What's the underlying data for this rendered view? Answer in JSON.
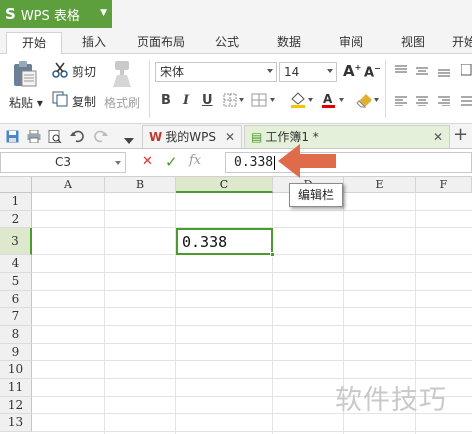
{
  "app": {
    "logo": "S",
    "name": "WPS 表格"
  },
  "ribbon": {
    "active_tab": "开始",
    "tabs": [
      "插入",
      "页面布局",
      "公式",
      "数据",
      "审阅",
      "视图",
      "开始"
    ]
  },
  "toolbar": {
    "paste": "粘贴",
    "cut": "剪切",
    "copy": "复制",
    "format_painter": "格式刷",
    "font_name": "宋体",
    "font_size": "14",
    "bold": "B",
    "italic": "I",
    "underline": "U",
    "grow_font": "A",
    "shrink_font": "A",
    "font_color": "A"
  },
  "quick_access": {
    "doc_tabs": [
      {
        "label": "我的WPS",
        "active": false
      },
      {
        "label": "工作簿1 *",
        "active": true
      }
    ],
    "add_tab": "+"
  },
  "formula_bar": {
    "name_box": "C3",
    "cancel": "✕",
    "confirm": "✓",
    "fx": "fx",
    "value": "0.338"
  },
  "grid": {
    "columns": [
      "A",
      "B",
      "C",
      "D",
      "E",
      "F"
    ],
    "rows": [
      "1",
      "2",
      "3",
      "4",
      "5",
      "6",
      "7",
      "8",
      "9",
      "10",
      "11",
      "12",
      "13"
    ],
    "selected_cell": {
      "column": "C",
      "row": "3"
    },
    "cell_value": "0.338"
  },
  "annotation": {
    "tooltip": "编辑栏"
  },
  "watermark": "软件技巧",
  "colors": {
    "accent": "#4b9b2c",
    "brand": "#5d9f3c",
    "arrow": "#e06b4a",
    "wps_red": "#c0392b"
  }
}
